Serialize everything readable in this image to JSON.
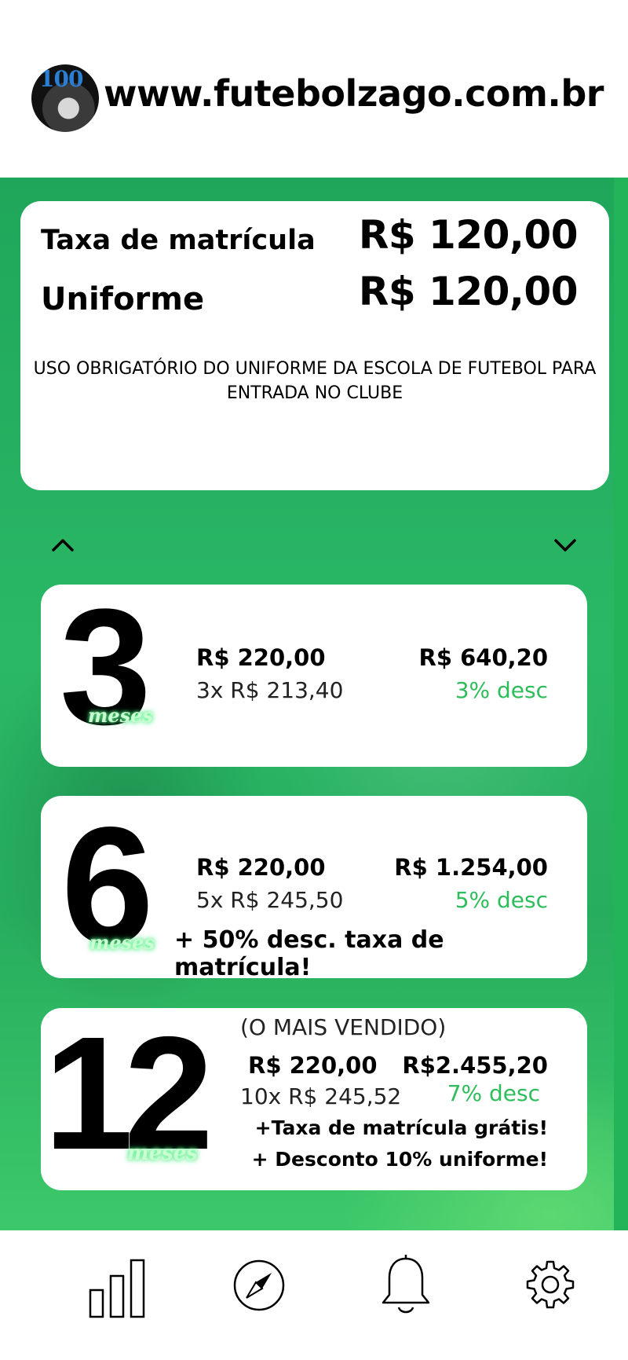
{
  "header": {
    "logo_text": "100",
    "site_url": "www.futebolzago.com.br"
  },
  "fees": {
    "enrollment_label": "Taxa de matrícula",
    "enrollment_value": "R$ 120,00",
    "uniform_label": "Uniforme",
    "uniform_value": "R$ 120,00",
    "notice": "USO OBRIGATÓRIO DO UNIFORME DA ESCOLA DE FUTEBOL PARA ENTRADA NO CLUBE"
  },
  "carousel": {
    "prev_icon": "chevron-up-icon",
    "next_icon": "chevron-down-icon"
  },
  "plans": [
    {
      "number": "3",
      "unit": "meses",
      "monthly": "R$ 220,00",
      "installments": "3x R$ 213,40",
      "total": "R$ 640,20",
      "discount": "3% desc"
    },
    {
      "number": "6",
      "unit": "meses",
      "monthly": "R$ 220,00",
      "installments": "5x R$ 245,50",
      "total": "R$ 1.254,00",
      "discount": "5% desc",
      "promo": "+ 50% desc. taxa de matrícula!"
    },
    {
      "number": "12",
      "unit": "meses",
      "tag": "(O MAIS VENDIDO)",
      "monthly": "R$ 220,00",
      "installments": "10x R$ 245,52",
      "total": "R$2.455,20",
      "discount": "7% desc",
      "promo_1": "+Taxa de matrícula grátis!",
      "promo_2": "+ Desconto 10% uniforme!"
    }
  ],
  "nav": {
    "items": [
      "bar-chart-icon",
      "compass-icon",
      "bell-icon",
      "gear-icon"
    ]
  },
  "colors": {
    "brand_green": "#27ad5e",
    "discount_green": "#2dbd5a"
  }
}
